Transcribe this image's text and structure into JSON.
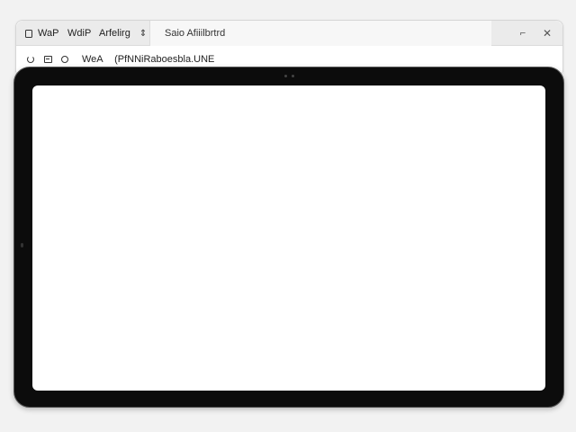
{
  "titlebar": {
    "tabs": [
      {
        "label": "WaP"
      },
      {
        "label": "WdiP"
      },
      {
        "label": "Arfelirg"
      }
    ],
    "active_tab": {
      "label": "Saio Afiiilbrtrd"
    },
    "minimize_glyph": "⌐",
    "close_glyph": "✕",
    "switch_glyph": "⇕"
  },
  "toolbar": {
    "icons": [
      "refresh-icon",
      "tabs-icon",
      "search-icon"
    ],
    "url_prefix": "WeA",
    "url_text": "(PfNNiRaboesbla.UNE"
  },
  "device": {
    "frame_color": "#0c0c0c",
    "screen_color": "#ffffff"
  }
}
